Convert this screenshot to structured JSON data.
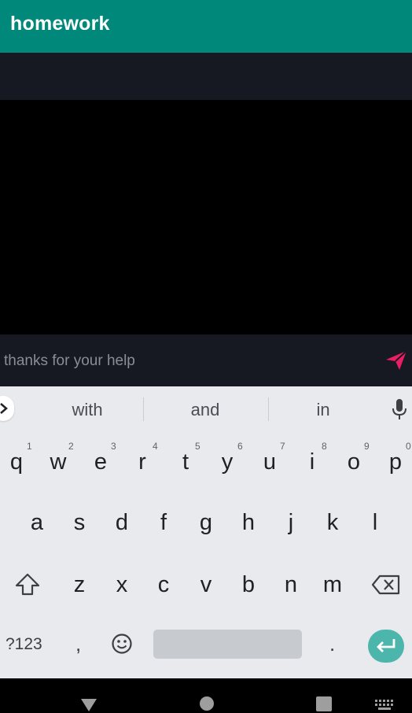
{
  "app": {
    "title": "homework"
  },
  "composer": {
    "placeholder": "thanks for your help"
  },
  "suggestions": [
    "with",
    "and",
    "in"
  ],
  "keyboard": {
    "row1": [
      {
        "key": "q",
        "hint": "1"
      },
      {
        "key": "w",
        "hint": "2"
      },
      {
        "key": "e",
        "hint": "3"
      },
      {
        "key": "r",
        "hint": "4"
      },
      {
        "key": "t",
        "hint": "5"
      },
      {
        "key": "y",
        "hint": "6"
      },
      {
        "key": "u",
        "hint": "7"
      },
      {
        "key": "i",
        "hint": "8"
      },
      {
        "key": "o",
        "hint": "9"
      },
      {
        "key": "p",
        "hint": "0"
      }
    ],
    "row2": [
      "a",
      "s",
      "d",
      "f",
      "g",
      "h",
      "j",
      "k",
      "l"
    ],
    "row3": [
      "z",
      "x",
      "c",
      "v",
      "b",
      "n",
      "m"
    ],
    "symbols_label": "?123",
    "comma": ",",
    "period": "."
  },
  "colors": {
    "appbar": "#00897b",
    "accent": "#e91e63",
    "enter": "#4db6ac"
  }
}
